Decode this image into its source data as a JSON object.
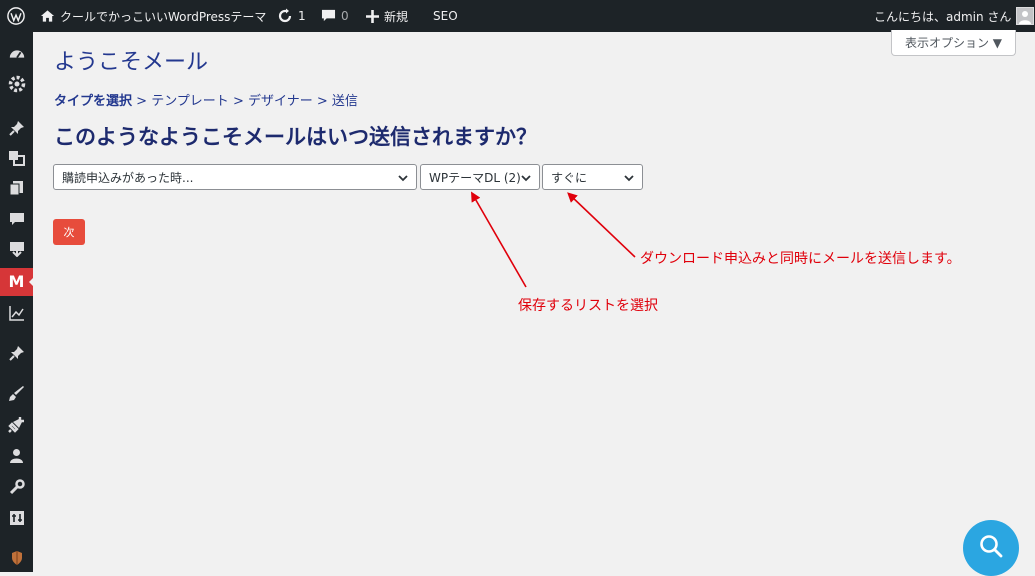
{
  "admin_bar": {
    "site_name": "クールでかっこいいWordPressテーマ",
    "updates_count": "1",
    "comments_count": "0",
    "new_label": "新規",
    "seo_label": "SEO",
    "greeting": "こんにちは、admin さん"
  },
  "screen_options": {
    "label": "表示オプション ▼"
  },
  "page": {
    "title": "ようこそメール",
    "breadcrumb": {
      "step1": "タイプを選択",
      "sep": " > ",
      "step2": "テンプレート",
      "step3": "デザイナー",
      "step4": "送信"
    },
    "question": "このようなようこそメールはいつ送信されますか？",
    "selects": {
      "trigger": "購読申込みがあった時...",
      "list": "WPテーマDL (2)",
      "timing": "すぐに"
    },
    "next_button": "次"
  },
  "annotations": {
    "list_note": "保存するリストを選択",
    "timing_note": "ダウンロード申込みと同時にメールを送信します。"
  },
  "colors": {
    "admin_bar_bg": "#1d2327",
    "accent_red": "#e0000b",
    "next_button": "#e74c3c",
    "help_fab": "#2ba6e1"
  }
}
